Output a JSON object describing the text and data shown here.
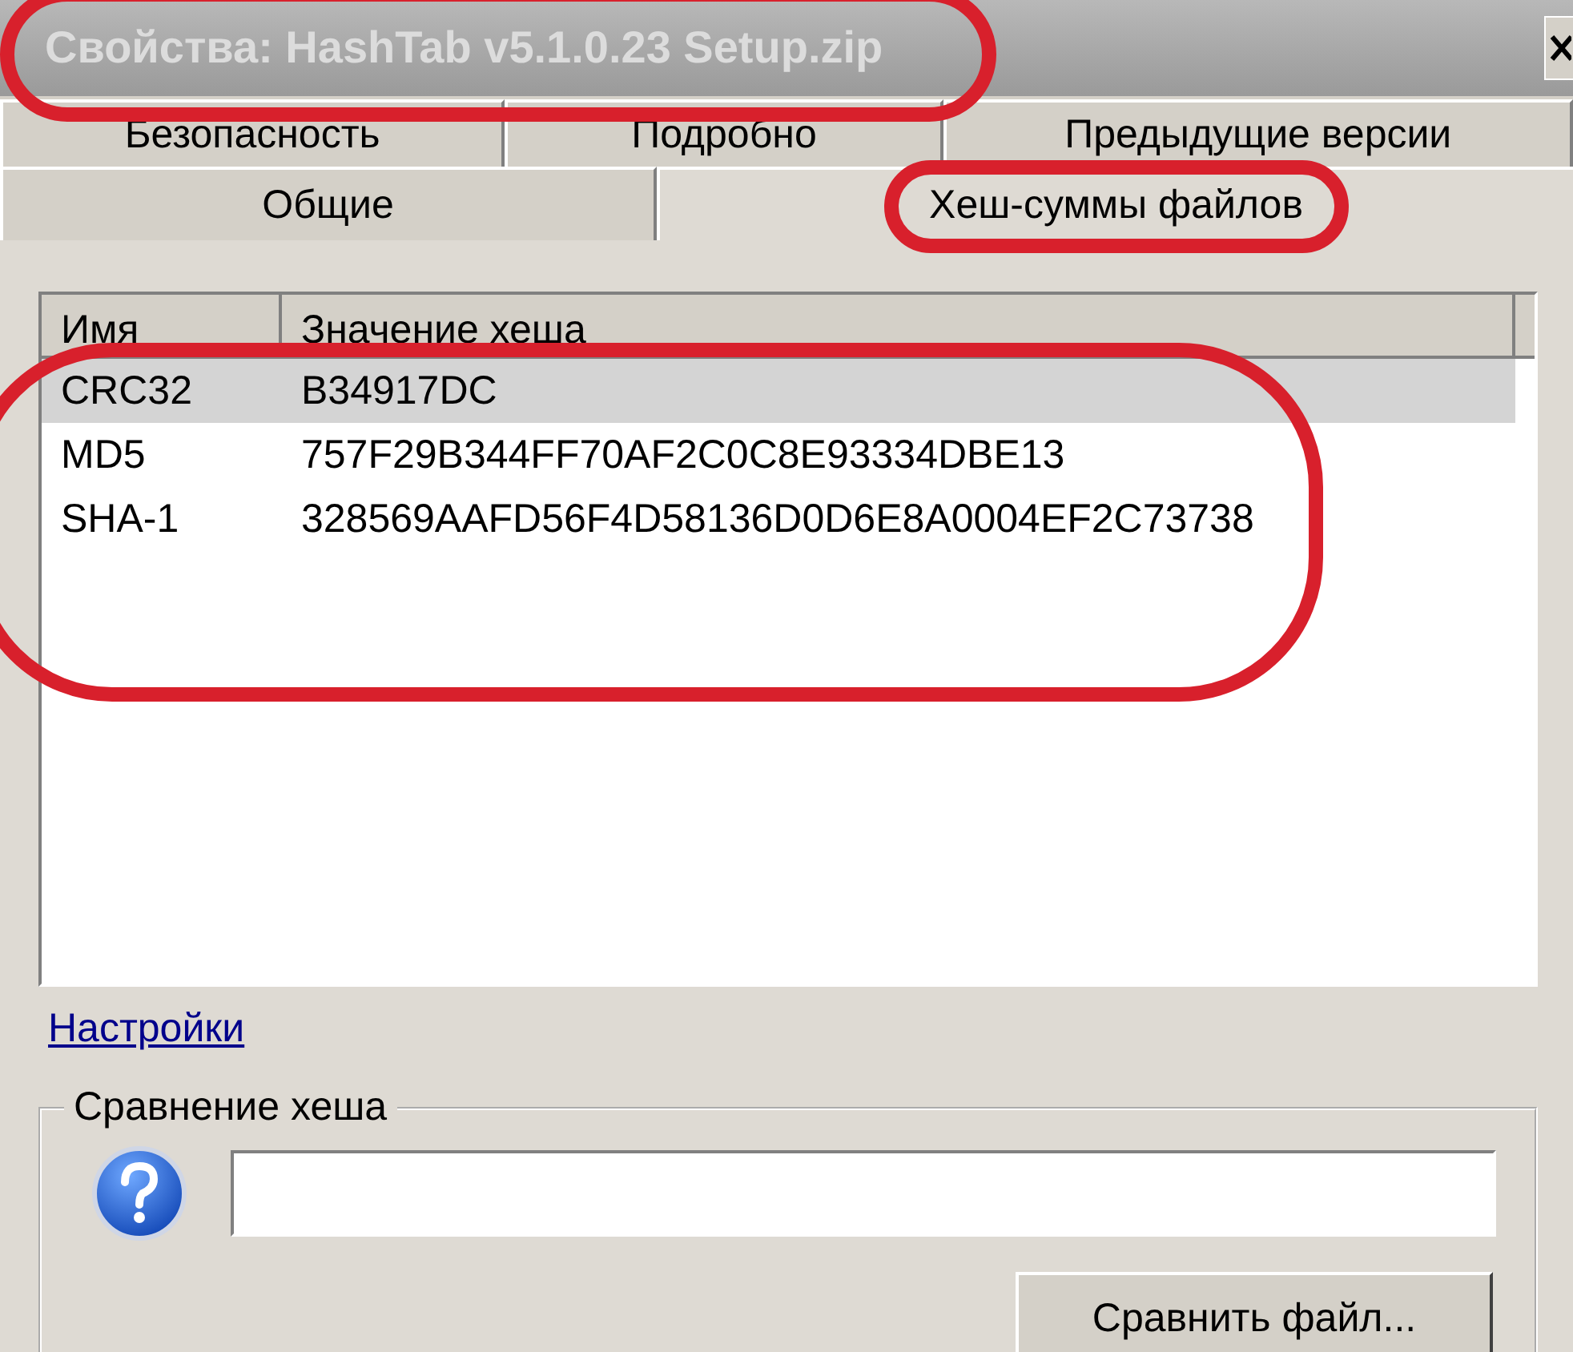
{
  "window": {
    "title": "Свойства: HashTab v5.1.0.23 Setup.zip"
  },
  "tab_rows": [
    [
      {
        "label": "Безопасность",
        "selected": false
      },
      {
        "label": "Подробно",
        "selected": false
      },
      {
        "label": "Предыдущие версии",
        "selected": false
      }
    ],
    [
      {
        "label": "Общие",
        "selected": false
      },
      {
        "label": "Хеш-суммы файлов",
        "selected": true
      }
    ]
  ],
  "hash_list": {
    "columns": [
      "Имя",
      "Значение хеша"
    ],
    "rows": [
      {
        "name": "CRC32",
        "value": "B34917DC",
        "selected": true
      },
      {
        "name": "MD5",
        "value": "757F29B344FF70AF2C0C8E93334DBE13",
        "selected": false
      },
      {
        "name": "SHA-1",
        "value": "328569AAFD56F4D58136D0D6E8A0004EF2C73738",
        "selected": false
      }
    ]
  },
  "settings_link": "Настройки",
  "compare_group": {
    "title": "Сравнение хеша",
    "button": "Сравнить файл..."
  }
}
